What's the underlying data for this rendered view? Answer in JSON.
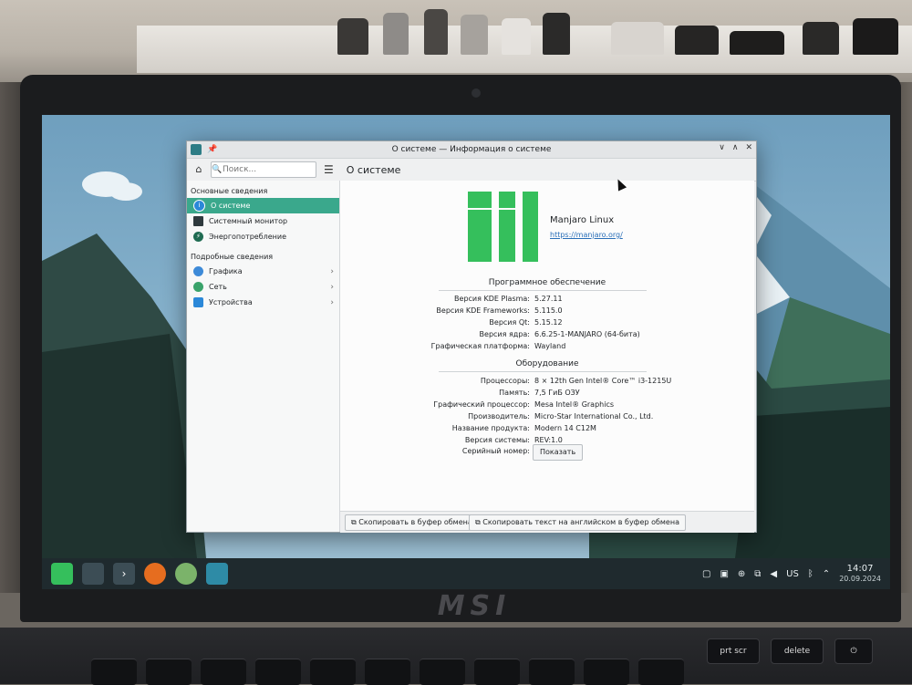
{
  "window": {
    "title": "О системе — Информация о системе",
    "pin_glyph": "📌",
    "controls": [
      "∨",
      "∧",
      "✕"
    ]
  },
  "toolbar": {
    "home_glyph": "⌂",
    "search_placeholder": "Поиск...",
    "search_glyph": "🔍",
    "menu_glyph": "☰",
    "page_title": "О системе"
  },
  "sidebar": {
    "section1": "Основные сведения",
    "items1": [
      {
        "label": "О системе",
        "icon": "info-icon",
        "color": "#2b88d8",
        "active": true
      },
      {
        "label": "Системный монитор",
        "icon": "monitor-icon",
        "color": "#2f3a3e"
      },
      {
        "label": "Энергопотребление",
        "icon": "power-icon",
        "color": "#1f6b52"
      }
    ],
    "section2": "Подробные сведения",
    "items2": [
      {
        "label": "Графика",
        "icon": "graphics-icon",
        "color": "#3d8ad8"
      },
      {
        "label": "Сеть",
        "icon": "network-icon",
        "color": "#3aa36b"
      },
      {
        "label": "Устройства",
        "icon": "devices-icon",
        "color": "#2b88d8"
      }
    ],
    "chevron": "›"
  },
  "distro": {
    "name": "Manjaro Linux",
    "url": "https://manjaro.org/",
    "logo_color": "#35bf5c"
  },
  "software": {
    "heading": "Программное обеспечение",
    "rows": [
      {
        "k": "Версия KDE Plasma:",
        "v": "5.27.11"
      },
      {
        "k": "Версия KDE Frameworks:",
        "v": "5.115.0"
      },
      {
        "k": "Версия Qt:",
        "v": "5.15.12"
      },
      {
        "k": "Версия ядра:",
        "v": "6.6.25-1-MANJARO (64-бита)"
      },
      {
        "k": "Графическая платформа:",
        "v": "Wayland"
      }
    ]
  },
  "hardware": {
    "heading": "Оборудование",
    "rows": [
      {
        "k": "Процессоры:",
        "v": "8 × 12th Gen Intel® Core™ i3-1215U"
      },
      {
        "k": "Память:",
        "v": "7,5 ГиБ ОЗУ"
      },
      {
        "k": "Графический процессор:",
        "v": "Mesa Intel® Graphics"
      },
      {
        "k": "Производитель:",
        "v": "Micro-Star International Co., Ltd."
      },
      {
        "k": "Название продукта:",
        "v": "Modern 14 C12M"
      },
      {
        "k": "Версия системы:",
        "v": "REV:1.0"
      }
    ],
    "serial_label": "Серийный номер:",
    "show_button": "Показать"
  },
  "footer": {
    "copy_button": "Скопировать в буфер обмена",
    "copy_en_button": "Скопировать текст на английском в буфер обмена",
    "copy_glyph": "⧉"
  },
  "taskbar": {
    "layout": "US",
    "time": "14:07",
    "date": "20.09.2024"
  },
  "laptop": {
    "brand": "MSI",
    "keys": [
      "prt scr",
      "delete",
      "⏻"
    ]
  }
}
